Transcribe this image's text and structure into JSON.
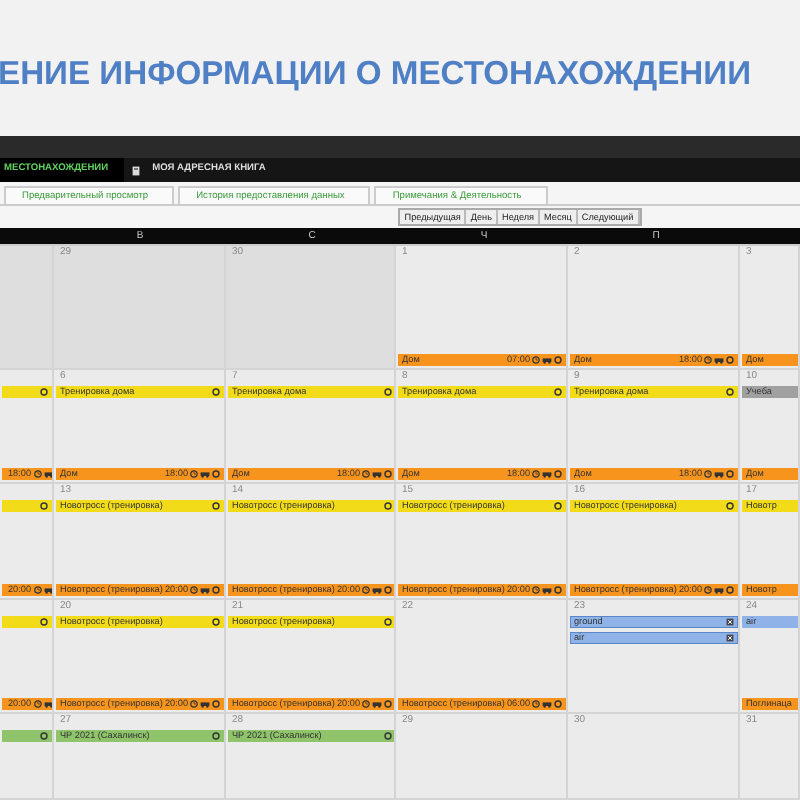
{
  "slide_title": "ЕНИЕ ИНФОРМАЦИИ О МЕСТОНАХОЖДЕНИИ",
  "nav_tabs": [
    {
      "label": "МЕСТОНАХОЖДЕНИИ",
      "selected": true
    },
    {
      "label": "МОЯ АДРЕСНАЯ КНИГА",
      "selected": false
    }
  ],
  "sub_tabs": [
    "Предварительный просмотр",
    "История предоставления данных",
    "Примечания & Деятельность"
  ],
  "view_buttons": [
    "Предыдущая",
    "День",
    "Неделя",
    "Месяц",
    "Следующий"
  ],
  "weekdays": [
    "В",
    "С",
    "Ч",
    "П"
  ],
  "weeks": [
    {
      "days": [
        {
          "outside_month": true
        },
        {
          "date": "29",
          "outside_month": true
        },
        {
          "date": "30",
          "outside_month": true
        },
        {
          "date": "1",
          "outside_month": false,
          "bottom_events": [
            {
              "kind": "timed",
              "color": "#f7941d",
              "title": "Дом",
              "time": "07:00"
            }
          ]
        },
        {
          "date": "2",
          "outside_month": false,
          "bottom_events": [
            {
              "kind": "timed",
              "color": "#f7941d",
              "title": "Дом",
              "time": "18:00"
            }
          ]
        },
        {
          "date": "3",
          "outside_month": false,
          "bottom_events": [
            {
              "kind": "plain",
              "color": "#f7941d",
              "title": "Дом"
            }
          ]
        }
      ]
    },
    {
      "days": [
        {
          "top_events": [
            {
              "kind": "allday",
              "color": "#f2dc1a"
            }
          ],
          "bottom_events": [
            {
              "kind": "timed",
              "color": "#f7941d",
              "time": "18:00"
            }
          ]
        },
        {
          "date": "6",
          "outside_month": false,
          "top_events": [
            {
              "kind": "allday",
              "color": "#f2dc1a",
              "title": "Тренировка дома"
            }
          ],
          "bottom_events": [
            {
              "kind": "timed",
              "color": "#f7941d",
              "title": "Дом",
              "time": "18:00"
            }
          ]
        },
        {
          "date": "7",
          "outside_month": false,
          "top_events": [
            {
              "kind": "allday",
              "color": "#f2dc1a",
              "title": "Тренировка дома"
            }
          ],
          "bottom_events": [
            {
              "kind": "timed",
              "color": "#f7941d",
              "title": "Дом",
              "time": "18:00"
            }
          ]
        },
        {
          "date": "8",
          "outside_month": false,
          "top_events": [
            {
              "kind": "allday",
              "color": "#f2dc1a",
              "title": "Тренировка дома"
            }
          ],
          "bottom_events": [
            {
              "kind": "timed",
              "color": "#f7941d",
              "title": "Дом",
              "time": "18:00"
            }
          ]
        },
        {
          "date": "9",
          "outside_month": false,
          "top_events": [
            {
              "kind": "allday",
              "color": "#f2dc1a",
              "title": "Тренировка дома"
            }
          ],
          "bottom_events": [
            {
              "kind": "timed",
              "color": "#f7941d",
              "title": "Дом",
              "time": "18:00"
            }
          ]
        },
        {
          "date": "10",
          "outside_month": false,
          "top_events": [
            {
              "kind": "plain",
              "color": "#a0a0a0",
              "title": "Учеба"
            }
          ],
          "bottom_events": [
            {
              "kind": "plain",
              "color": "#f7941d",
              "title": "Дом"
            }
          ]
        }
      ]
    },
    {
      "days": [
        {
          "top_events": [
            {
              "kind": "allday",
              "color": "#f2dc1a"
            }
          ],
          "bottom_events": [
            {
              "kind": "timed",
              "color": "#f7941d",
              "time": "20:00"
            }
          ]
        },
        {
          "date": "13",
          "outside_month": false,
          "top_events": [
            {
              "kind": "allday",
              "color": "#f2dc1a",
              "title": "Новотросс (тренировка)"
            }
          ],
          "bottom_events": [
            {
              "kind": "timed",
              "color": "#f7941d",
              "title": "Новотросс (тренировка)",
              "time": "20:00"
            }
          ]
        },
        {
          "date": "14",
          "outside_month": false,
          "top_events": [
            {
              "kind": "allday",
              "color": "#f2dc1a",
              "title": "Новотросс (тренировка)"
            }
          ],
          "bottom_events": [
            {
              "kind": "timed",
              "color": "#f7941d",
              "title": "Новотросс (тренировка)",
              "time": "20:00"
            }
          ]
        },
        {
          "date": "15",
          "outside_month": false,
          "top_events": [
            {
              "kind": "allday",
              "color": "#f2dc1a",
              "title": "Новотросс (тренировка)"
            }
          ],
          "bottom_events": [
            {
              "kind": "timed",
              "color": "#f7941d",
              "title": "Новотросс (тренировка)",
              "time": "20:00"
            }
          ]
        },
        {
          "date": "16",
          "outside_month": false,
          "top_events": [
            {
              "kind": "allday",
              "color": "#f2dc1a",
              "title": "Новотросс (тренировка)"
            }
          ],
          "bottom_events": [
            {
              "kind": "timed",
              "color": "#f7941d",
              "title": "Новотросс (тренировка)",
              "time": "20:00"
            }
          ]
        },
        {
          "date": "17",
          "outside_month": false,
          "top_events": [
            {
              "kind": "plain",
              "color": "#f2dc1a",
              "title": "Новотр"
            }
          ],
          "bottom_events": [
            {
              "kind": "plain",
              "color": "#f7941d",
              "title": "Новотр"
            }
          ]
        }
      ]
    },
    {
      "days": [
        {
          "top_events": [
            {
              "kind": "allday",
              "color": "#f2dc1a"
            }
          ],
          "bottom_events": [
            {
              "kind": "timed",
              "color": "#f7941d",
              "time": "20:00"
            }
          ]
        },
        {
          "date": "20",
          "outside_month": false,
          "top_events": [
            {
              "kind": "allday",
              "color": "#f2dc1a",
              "title": "Новотросс (тренировка)"
            }
          ],
          "bottom_events": [
            {
              "kind": "timed",
              "color": "#f7941d",
              "title": "Новотросс (тренировка)",
              "time": "20:00"
            }
          ]
        },
        {
          "date": "21",
          "outside_month": false,
          "top_events": [
            {
              "kind": "allday",
              "color": "#f2dc1a",
              "title": "Новотросс (тренировка)"
            }
          ],
          "bottom_events": [
            {
              "kind": "timed",
              "color": "#f7941d",
              "title": "Новотросс (тренировка)",
              "time": "20:00"
            }
          ]
        },
        {
          "date": "22",
          "outside_month": false,
          "bottom_events": [
            {
              "kind": "timed",
              "color": "#f7941d",
              "title": "Новотросс (тренировка)",
              "time": "06:00"
            }
          ]
        },
        {
          "date": "23",
          "outside_month": false,
          "top_events": [
            {
              "kind": "marked",
              "color": "#8fb3e8",
              "title": "ground"
            },
            {
              "kind": "marked",
              "color": "#8fb3e8",
              "title": "air"
            }
          ]
        },
        {
          "date": "24",
          "outside_month": false,
          "top_events": [
            {
              "kind": "plain",
              "color": "#8fb3e8",
              "title": "air"
            }
          ],
          "bottom_events": [
            {
              "kind": "plain",
              "color": "#f7941d",
              "title": "Поглинаца"
            }
          ]
        }
      ]
    },
    {
      "days": [
        {
          "top_events": [
            {
              "kind": "allday",
              "color": "#8fc46b"
            }
          ]
        },
        {
          "date": "27",
          "outside_month": false,
          "top_events": [
            {
              "kind": "allday",
              "color": "#8fc46b",
              "title": "ЧР 2021 (Сахалинск)"
            }
          ]
        },
        {
          "date": "28",
          "outside_month": false,
          "top_events": [
            {
              "kind": "allday",
              "color": "#8fc46b",
              "title": "ЧР 2021 (Сахалинск)"
            }
          ]
        },
        {
          "date": "29",
          "outside_month": false
        },
        {
          "date": "30",
          "outside_month": false
        },
        {
          "date": "31",
          "outside_month": false
        }
      ]
    }
  ]
}
